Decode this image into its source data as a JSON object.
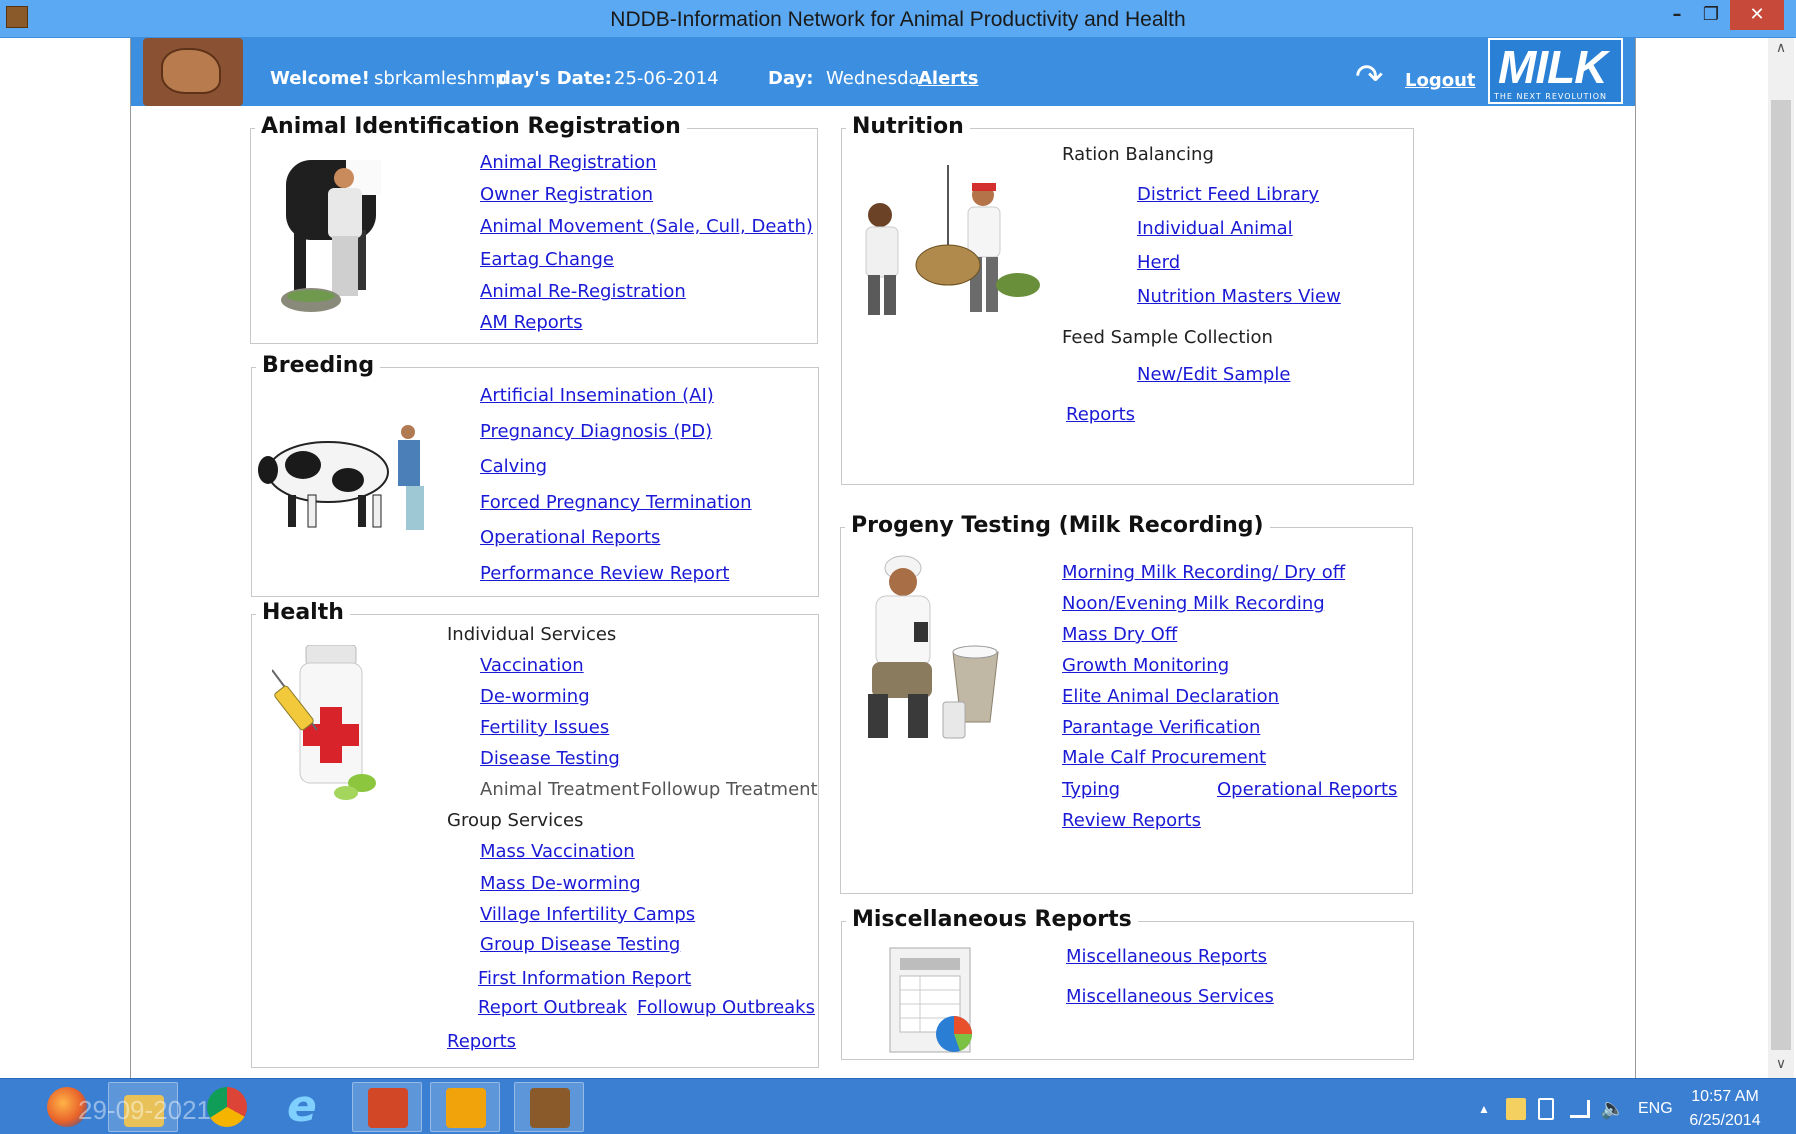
{
  "window": {
    "title": "NDDB-Information Network for Animal Productivity and Health",
    "min_glyph": "–",
    "max_glyph": "❐",
    "close_glyph": "✕"
  },
  "header": {
    "welcome_label": "Welcome!",
    "username": "sbrkamleshmp",
    "date_label": "day's Date:",
    "date_value": "25-06-2014",
    "day_label": "Day:",
    "day_value": "Wednesda",
    "alerts": "Alerts",
    "logout": "Logout",
    "logo_big": "MILK",
    "logo_small": "THE NEXT REVOLUTION"
  },
  "animal_id": {
    "title": "Animal Identification  Registration",
    "links": [
      "Animal Registration",
      "Owner Registration",
      "Animal Movement (Sale, Cull, Death)",
      "Eartag Change",
      "Animal Re-Registration",
      "AM Reports"
    ]
  },
  "breeding": {
    "title": "Breeding",
    "links": [
      "Artificial Insemination (AI)",
      "Pregnancy Diagnosis (PD)",
      "Calving",
      "Forced Pregnancy Termination",
      "Operational Reports",
      "Performance Review Report"
    ]
  },
  "health": {
    "title": "Health",
    "individual_label": "Individual Services",
    "individual_links": [
      "Vaccination",
      "De-worming",
      "Fertility Issues",
      "Disease Testing"
    ],
    "animal_treatment": "Animal Treatment",
    "followup_treatment": "Followup Treatment",
    "group_label": "Group Services",
    "group_links": [
      "Mass Vaccination",
      "Mass De-worming",
      "Village Infertility Camps",
      "Group Disease Testing"
    ],
    "first_info": "First Information Report",
    "report_outbreak": "Report Outbreak",
    "followup_outbreaks": "Followup Outbreaks",
    "reports": "Reports"
  },
  "nutrition": {
    "title": "Nutrition",
    "ration_label": "Ration Balancing",
    "ration_links": [
      "District Feed Library",
      "Individual Animal",
      "Herd",
      "Nutrition Masters View"
    ],
    "feed_label": "Feed Sample Collection",
    "feed_link": "New/Edit Sample",
    "reports": "Reports"
  },
  "progeny": {
    "title": "Progeny Testing (Milk Recording)",
    "links": [
      "Morning Milk Recording/ Dry off",
      "Noon/Evening Milk Recording",
      "Mass Dry Off",
      "Growth Monitoring",
      "Elite Animal Declaration",
      "Parantage Verification",
      "Male Calf Procurement"
    ],
    "typing": "Typing",
    "operational_reports": "Operational Reports",
    "review_reports": "Review Reports"
  },
  "misc": {
    "title": "Miscellaneous Reports",
    "links": [
      "Miscellaneous Reports",
      "Miscellaneous Services"
    ]
  },
  "taskbar": {
    "watermark": "29-09-2021",
    "lang": "ENG",
    "time": "10:57 AM",
    "date": "6/25/2014",
    "tray_up": "▲"
  },
  "scroll": {
    "up": "∧",
    "down": "∨"
  },
  "colors": {
    "header_blue": "#3c8fe0",
    "link_blue": "#1a1ad6",
    "titlebar_blue": "#5aa9f2",
    "taskbar_blue": "#3a7fd1",
    "close_red": "#c7493a"
  }
}
